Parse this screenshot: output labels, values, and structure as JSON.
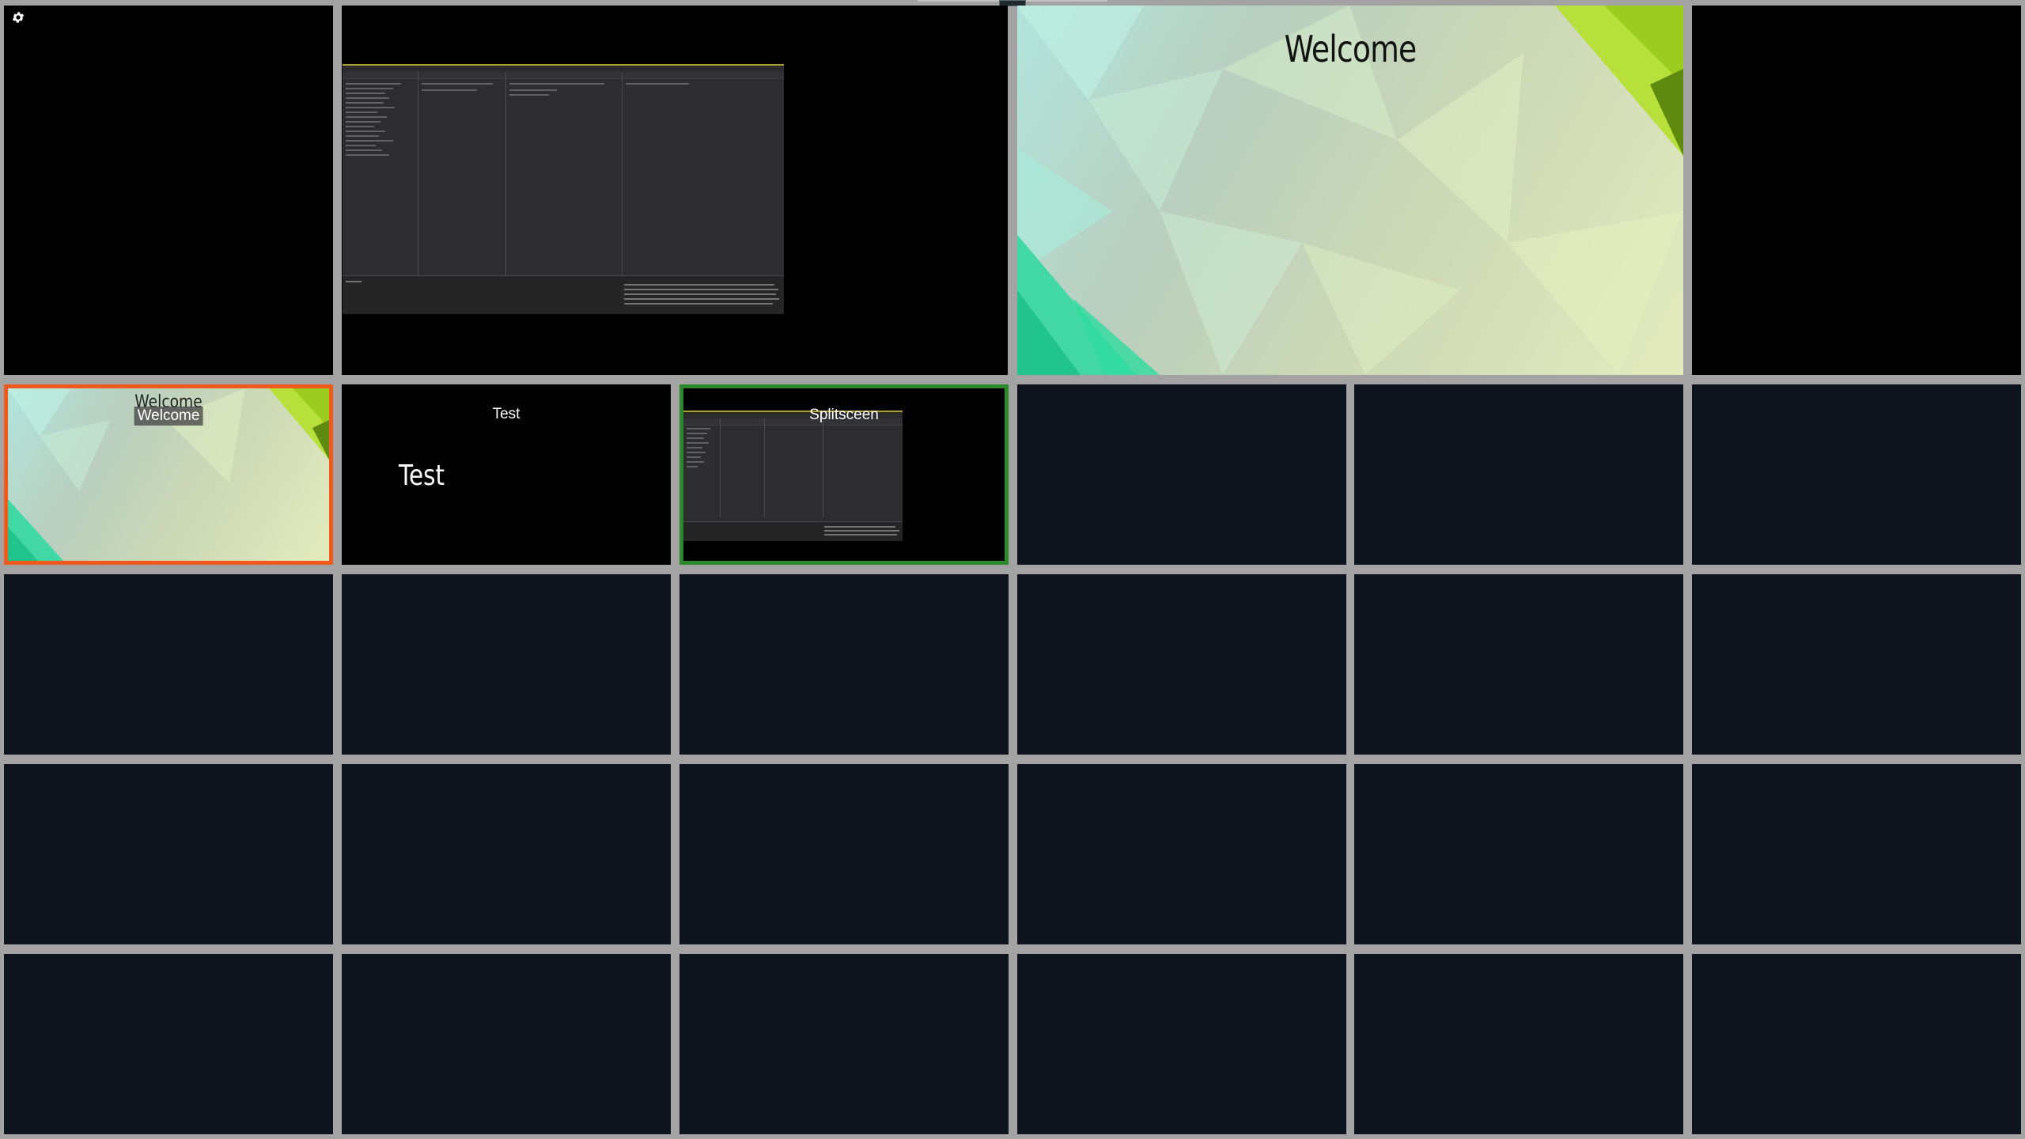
{
  "colors": {
    "grid_gap": "#a3a3a3",
    "black_tile": "#000000",
    "empty_tile": "#0d141d",
    "selected_program": "#ef5a1c",
    "selected_preview": "#2b8a2b"
  },
  "icons": {
    "settings": "gear-icon"
  },
  "top_row": {
    "preview_title": "Welcome"
  },
  "scenes": [
    {
      "caption": "Welcome",
      "overlay_title": "Welcome",
      "state": "program"
    },
    {
      "caption": "Test",
      "overlay_title": "Test",
      "state": "normal"
    },
    {
      "caption": "Splitsceen",
      "state": "preview"
    }
  ]
}
